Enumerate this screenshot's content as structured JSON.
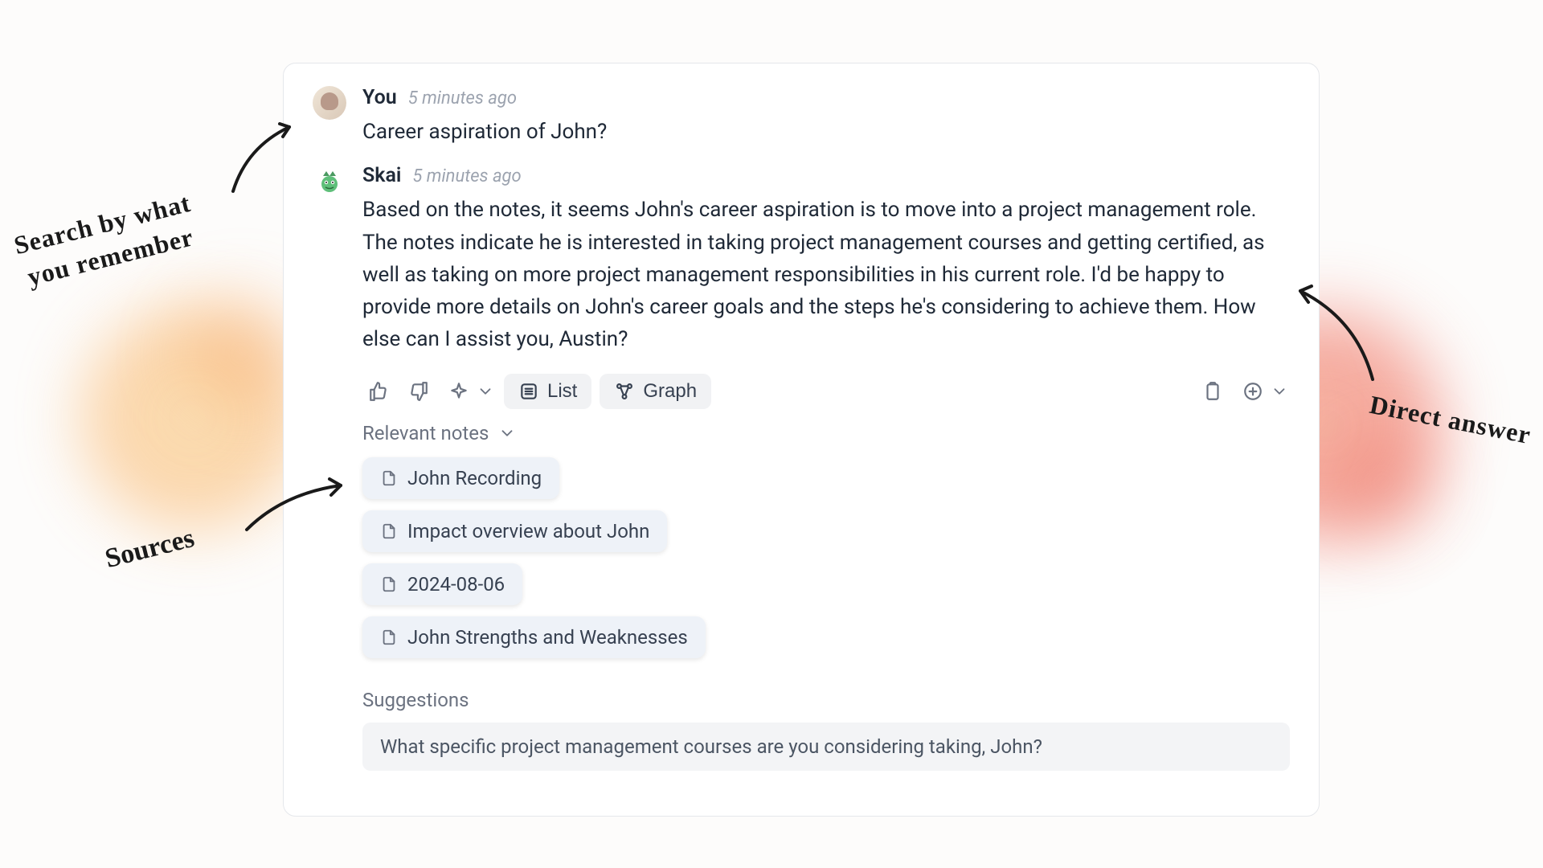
{
  "user_message": {
    "sender": "You",
    "timestamp": "5 minutes ago",
    "text": "Career aspiration of John?"
  },
  "bot_message": {
    "sender": "Skai",
    "timestamp": "5 minutes ago",
    "text": "Based on the notes, it seems John's career aspiration is to move into a project management role. The notes indicate he is interested in taking project management courses and getting certified, as well as taking on more project management responsibilities in his current role. I'd be happy to provide more details on John's career goals and the steps he's considering to achieve them. How else can I assist you, Austin?"
  },
  "actions": {
    "list_label": "List",
    "graph_label": "Graph"
  },
  "relevant_notes": {
    "header": "Relevant notes",
    "items": [
      {
        "title": "John Recording"
      },
      {
        "title": "Impact overview about John"
      },
      {
        "title": "2024-08-06"
      },
      {
        "title": "John Strengths and Weaknesses"
      }
    ]
  },
  "suggestions": {
    "header": "Suggestions",
    "items": [
      "What specific project management courses are you considering taking, John?"
    ]
  },
  "annotations": {
    "search_by": "Search by what\nyou remember",
    "sources": "Sources",
    "direct_answer": "Direct answer"
  }
}
